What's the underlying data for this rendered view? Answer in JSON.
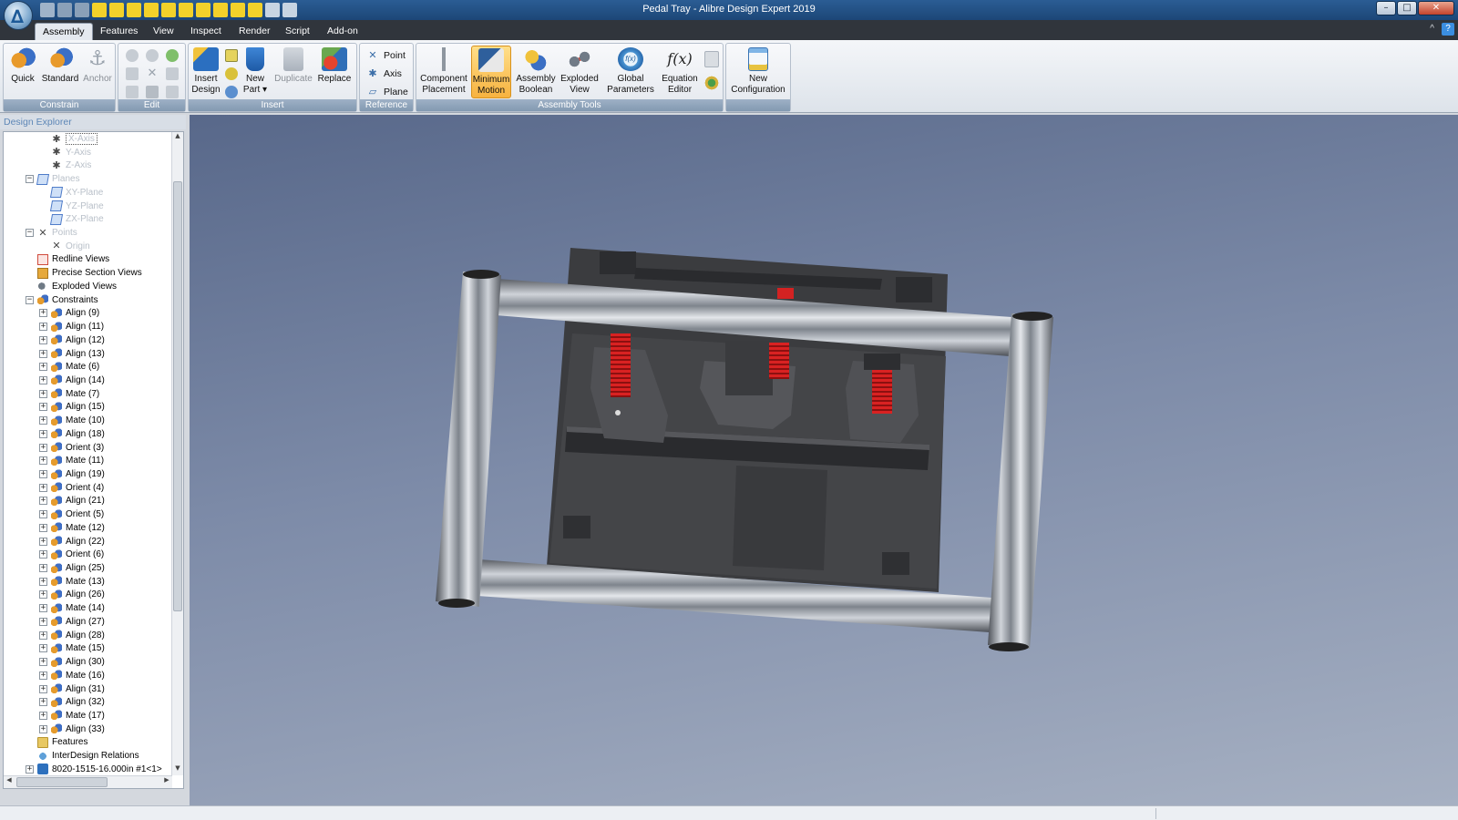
{
  "window": {
    "title": "Pedal Tray - Alibre Design Expert 2019",
    "app_icon": "alibre-logo",
    "controls": {
      "minimize": "–",
      "maximize": "□",
      "close": "✕"
    }
  },
  "tabs": [
    {
      "label": "Assembly",
      "active": true
    },
    {
      "label": "Features",
      "active": false
    },
    {
      "label": "View",
      "active": false
    },
    {
      "label": "Inspect",
      "active": false
    },
    {
      "label": "Render",
      "active": false
    },
    {
      "label": "Script",
      "active": false
    },
    {
      "label": "Add-on",
      "active": false
    }
  ],
  "tab_help": "?",
  "tab_minimize": "^",
  "ribbon": {
    "constrain": {
      "label": "Constrain",
      "quick": "Quick",
      "standard": "Standard",
      "anchor": "Anchor"
    },
    "edit": {
      "label": "Edit"
    },
    "insert": {
      "label": "Insert",
      "insert_design_line1": "Insert",
      "insert_design_line2": "Design",
      "new_part_line1": "New",
      "new_part_line2": "Part ▾",
      "duplicate": "Duplicate",
      "replace": "Replace"
    },
    "reference": {
      "label": "Reference",
      "point": "Point",
      "axis": "Axis",
      "plane": "Plane"
    },
    "assembly_tools": {
      "label": "Assembly Tools",
      "component_placement_line1": "Component",
      "component_placement_line2": "Placement",
      "minimum_motion_line1": "Minimum",
      "minimum_motion_line2": "Motion",
      "assembly_boolean_line1": "Assembly",
      "assembly_boolean_line2": "Boolean",
      "exploded_view_line1": "Exploded",
      "exploded_view_line2": "View",
      "global_parameters_line1": "Global",
      "global_parameters_line2": "Parameters",
      "equation_editor_glyph": "f(x)",
      "equation_editor_line1": "Equation",
      "equation_editor_line2": "Editor",
      "global_parameters_glyph": "f(x)"
    },
    "configuration": {
      "new_configuration_line1": "New",
      "new_configuration_line2": "Configuration"
    }
  },
  "explorer": {
    "title": "Design Explorer",
    "nodes": [
      {
        "label": "X-Axis",
        "indent": 3,
        "icon": "axis-icon",
        "expander": "none",
        "dim": true,
        "selected": true
      },
      {
        "label": "Y-Axis",
        "indent": 3,
        "icon": "axis-icon",
        "expander": "none",
        "dim": true
      },
      {
        "label": "Z-Axis",
        "indent": 3,
        "icon": "axis-icon",
        "expander": "none",
        "dim": true
      },
      {
        "label": "Planes",
        "indent": 2,
        "icon": "plane-icon",
        "expander": "−",
        "dim": true
      },
      {
        "label": "XY-Plane",
        "indent": 3,
        "icon": "plane-icon",
        "expander": "none",
        "dim": true
      },
      {
        "label": "YZ-Plane",
        "indent": 3,
        "icon": "plane-icon",
        "expander": "none",
        "dim": true
      },
      {
        "label": "ZX-Plane",
        "indent": 3,
        "icon": "plane-icon",
        "expander": "none",
        "dim": true
      },
      {
        "label": "Points",
        "indent": 2,
        "icon": "point-icon",
        "expander": "−",
        "dim": true
      },
      {
        "label": "Origin",
        "indent": 3,
        "icon": "point-icon",
        "expander": "none",
        "dim": true
      },
      {
        "label": "Redline Views",
        "indent": 2,
        "icon": "redline-icon",
        "expander": "none"
      },
      {
        "label": "Precise Section Views",
        "indent": 2,
        "icon": "section-icon",
        "expander": "none"
      },
      {
        "label": "Exploded Views",
        "indent": 2,
        "icon": "exploded-icon",
        "expander": "none"
      },
      {
        "label": "Constraints",
        "indent": 2,
        "icon": "constraint-icon",
        "expander": "−"
      },
      {
        "label": "Align (9)",
        "indent": 3,
        "icon": "constraint-icon",
        "expander": "+"
      },
      {
        "label": "Align (11)",
        "indent": 3,
        "icon": "constraint-icon",
        "expander": "+"
      },
      {
        "label": "Align (12)",
        "indent": 3,
        "icon": "constraint-icon",
        "expander": "+"
      },
      {
        "label": "Align (13)",
        "indent": 3,
        "icon": "constraint-icon",
        "expander": "+"
      },
      {
        "label": "Mate (6)",
        "indent": 3,
        "icon": "constraint-icon",
        "expander": "+"
      },
      {
        "label": "Align (14)",
        "indent": 3,
        "icon": "constraint-icon",
        "expander": "+"
      },
      {
        "label": "Mate (7)",
        "indent": 3,
        "icon": "constraint-icon",
        "expander": "+"
      },
      {
        "label": "Align (15)",
        "indent": 3,
        "icon": "constraint-icon",
        "expander": "+"
      },
      {
        "label": "Mate (10)",
        "indent": 3,
        "icon": "constraint-icon",
        "expander": "+"
      },
      {
        "label": "Align (18)",
        "indent": 3,
        "icon": "constraint-icon",
        "expander": "+"
      },
      {
        "label": "Orient (3)",
        "indent": 3,
        "icon": "constraint-icon",
        "expander": "+"
      },
      {
        "label": "Mate (11)",
        "indent": 3,
        "icon": "constraint-icon",
        "expander": "+"
      },
      {
        "label": "Align (19)",
        "indent": 3,
        "icon": "constraint-icon",
        "expander": "+"
      },
      {
        "label": "Orient (4)",
        "indent": 3,
        "icon": "constraint-icon",
        "expander": "+"
      },
      {
        "label": "Align (21)",
        "indent": 3,
        "icon": "constraint-icon",
        "expander": "+"
      },
      {
        "label": "Orient (5)",
        "indent": 3,
        "icon": "constraint-icon",
        "expander": "+"
      },
      {
        "label": "Mate (12)",
        "indent": 3,
        "icon": "constraint-icon",
        "expander": "+"
      },
      {
        "label": "Align (22)",
        "indent": 3,
        "icon": "constraint-icon",
        "expander": "+"
      },
      {
        "label": "Orient (6)",
        "indent": 3,
        "icon": "constraint-icon",
        "expander": "+"
      },
      {
        "label": "Align (25)",
        "indent": 3,
        "icon": "constraint-icon",
        "expander": "+"
      },
      {
        "label": "Mate (13)",
        "indent": 3,
        "icon": "constraint-icon",
        "expander": "+"
      },
      {
        "label": "Align (26)",
        "indent": 3,
        "icon": "constraint-icon",
        "expander": "+"
      },
      {
        "label": "Mate (14)",
        "indent": 3,
        "icon": "constraint-icon",
        "expander": "+"
      },
      {
        "label": "Align (27)",
        "indent": 3,
        "icon": "constraint-icon",
        "expander": "+"
      },
      {
        "label": "Align (28)",
        "indent": 3,
        "icon": "constraint-icon",
        "expander": "+"
      },
      {
        "label": "Mate (15)",
        "indent": 3,
        "icon": "constraint-icon",
        "expander": "+"
      },
      {
        "label": "Align (30)",
        "indent": 3,
        "icon": "constraint-icon",
        "expander": "+"
      },
      {
        "label": "Mate (16)",
        "indent": 3,
        "icon": "constraint-icon",
        "expander": "+"
      },
      {
        "label": "Align (31)",
        "indent": 3,
        "icon": "constraint-icon",
        "expander": "+"
      },
      {
        "label": "Align (32)",
        "indent": 3,
        "icon": "constraint-icon",
        "expander": "+"
      },
      {
        "label": "Mate (17)",
        "indent": 3,
        "icon": "constraint-icon",
        "expander": "+"
      },
      {
        "label": "Align (33)",
        "indent": 3,
        "icon": "constraint-icon",
        "expander": "+"
      },
      {
        "label": "Features",
        "indent": 2,
        "icon": "features-folder-icon",
        "expander": "none"
      },
      {
        "label": "InterDesign Relations",
        "indent": 2,
        "icon": "interdesign-icon",
        "expander": "none"
      },
      {
        "label": "8020-1515-16.000in #1<1>",
        "indent": 2,
        "icon": "part-icon",
        "expander": "+"
      }
    ]
  },
  "colors": {
    "title_bar": "#1c4677",
    "tab_strip": "#30353c",
    "active_tool": "#f7b23f",
    "viewport_top": "#58688a",
    "viewport_bottom": "#a6b0c2",
    "spring": "#c81e1e"
  }
}
